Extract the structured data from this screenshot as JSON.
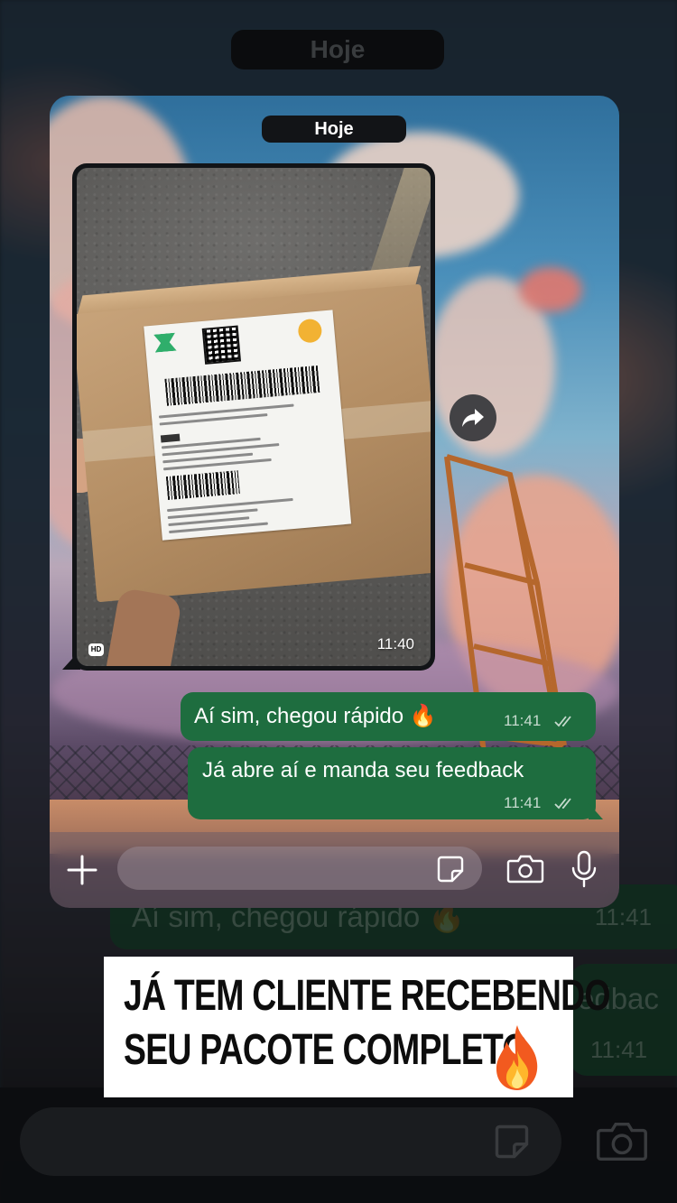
{
  "background": {
    "date_pill": "Hoje",
    "message_1": {
      "text": "Aí sim, chegou rápido",
      "emoji": "🔥",
      "time": "11:41"
    },
    "message_2": {
      "text_fragment": "edbac",
      "time": "11:41"
    }
  },
  "chat": {
    "date_separator": "Hoje",
    "media_message": {
      "type": "photo",
      "quality_badge": "HD",
      "time": "11:40",
      "description_icon": "forward-icon"
    },
    "messages": [
      {
        "text": "Aí sim, chegou rápido",
        "emoji": "🔥",
        "time": "11:41",
        "status": "read"
      },
      {
        "text": "Já abre aí e manda seu feedback",
        "time": "11:41",
        "status": "read"
      }
    ],
    "composer": {
      "placeholder": "",
      "icons": [
        "plus-icon",
        "sticker-icon",
        "camera-icon",
        "microphone-icon"
      ]
    }
  },
  "caption": {
    "line_1": "JÁ TEM CLIENTE RECEBENDO",
    "line_2": "SEU PACOTE COMPLETO",
    "emoji": "🔥"
  },
  "colors": {
    "outgoing_bubble": "#1e6d3f",
    "pill_dark": "#121417",
    "caption_bg": "#ffffff"
  }
}
